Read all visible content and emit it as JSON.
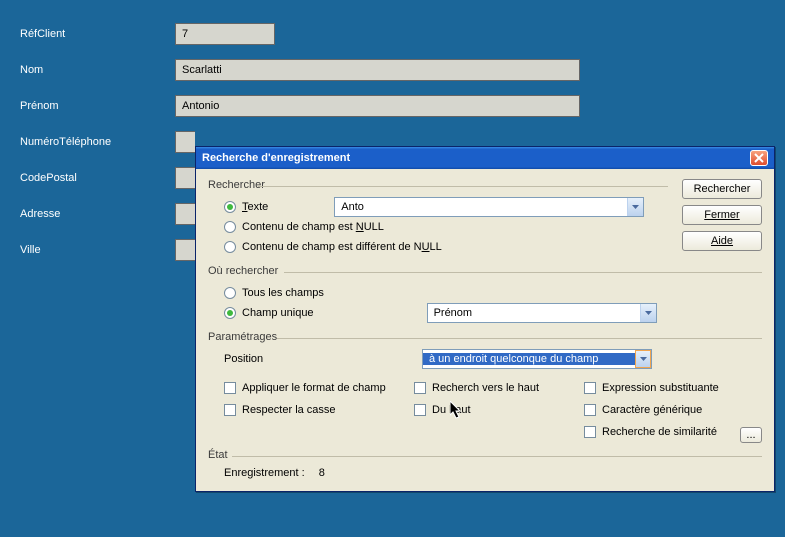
{
  "form": {
    "labels": {
      "ref": "RéfClient",
      "nom": "Nom",
      "prenom": "Prénom",
      "tel": "NuméroTéléphone",
      "cp": "CodePostal",
      "adresse": "Adresse",
      "ville": "Ville"
    },
    "values": {
      "ref": "7",
      "nom": "Scarlatti",
      "prenom": "Antonio"
    }
  },
  "dialog": {
    "title": "Recherche d'enregistrement",
    "buttons": {
      "search": "Rechercher",
      "close": "Fermer",
      "help": "Aide",
      "more": "..."
    },
    "groups": {
      "rechercher": "Rechercher",
      "ou": "Où rechercher",
      "param": "Paramétrages",
      "etat": "État"
    },
    "options": {
      "texte_pre": "T",
      "texte_post": "exte",
      "null_pre": "Contenu de champ est ",
      "null_u": "N",
      "null_post": "ULL",
      "notnull_pre": "Contenu de champ est différent de N",
      "notnull_u": "U",
      "notnull_post": "LL",
      "tous": "Tous les champs",
      "unique": "Champ unique"
    },
    "search_text": "Anto",
    "field_combo": "Prénom",
    "position_label": "Position",
    "position_value": "à un endroit quelconque du champ",
    "checks": {
      "format": "Appliquer le format de champ",
      "casse": "Respecter la casse",
      "haut_pre": "Recherch",
      "haut_post": "  vers le haut",
      "duhaut": "Du haut",
      "expr": "Expression substituante",
      "gener": "Caractère générique",
      "simil": "Recherche de similarité"
    },
    "etat": {
      "label": "Enregistrement :",
      "value": "8"
    }
  }
}
